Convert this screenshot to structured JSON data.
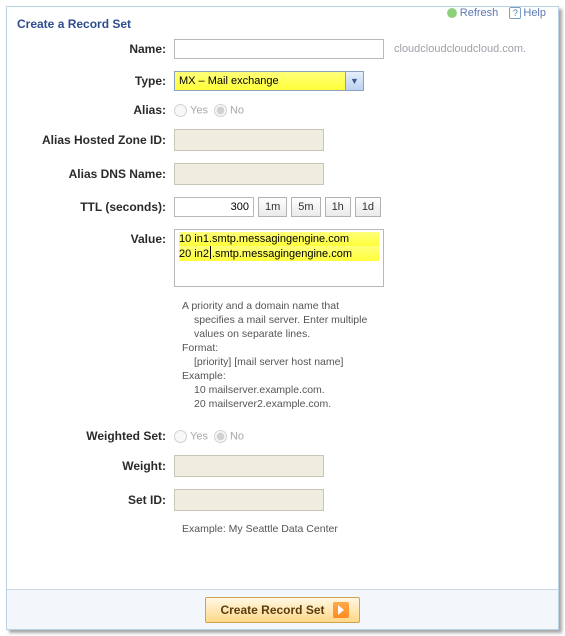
{
  "top": {
    "refresh": "Refresh",
    "help": "Help"
  },
  "panel_title": "Create a Record Set",
  "labels": {
    "name": "Name:",
    "type": "Type:",
    "alias": "Alias:",
    "alias_zone": "Alias Hosted Zone ID:",
    "alias_dns": "Alias DNS Name:",
    "ttl": "TTL (seconds):",
    "value": "Value:",
    "weighted": "Weighted Set:",
    "weight": "Weight:",
    "set_id": "Set ID:"
  },
  "name_suffix": "cloudcloudcloudcloud.com.",
  "type_selected": "MX – Mail exchange",
  "radio": {
    "yes": "Yes",
    "no": "No"
  },
  "ttl": {
    "value": "300",
    "b1": "1m",
    "b2": "5m",
    "b3": "1h",
    "b4": "1d"
  },
  "value_lines": {
    "l1": "10 in1.smtp.messagingengine.com",
    "l2_a": "20 in2",
    "l2_b": ".smtp.messagingengine.com"
  },
  "help": {
    "l1": "A priority and a domain name that",
    "l2": "specifies a mail server. Enter multiple",
    "l3": "values on separate lines.",
    "l4": "Format:",
    "l5": "[priority] [mail server host name]",
    "l6": "Example:",
    "l7": "10 mailserver.example.com.",
    "l8": "20 mailserver2.example.com."
  },
  "setid_example": "Example: My Seattle Data Center",
  "submit": "Create Record Set"
}
